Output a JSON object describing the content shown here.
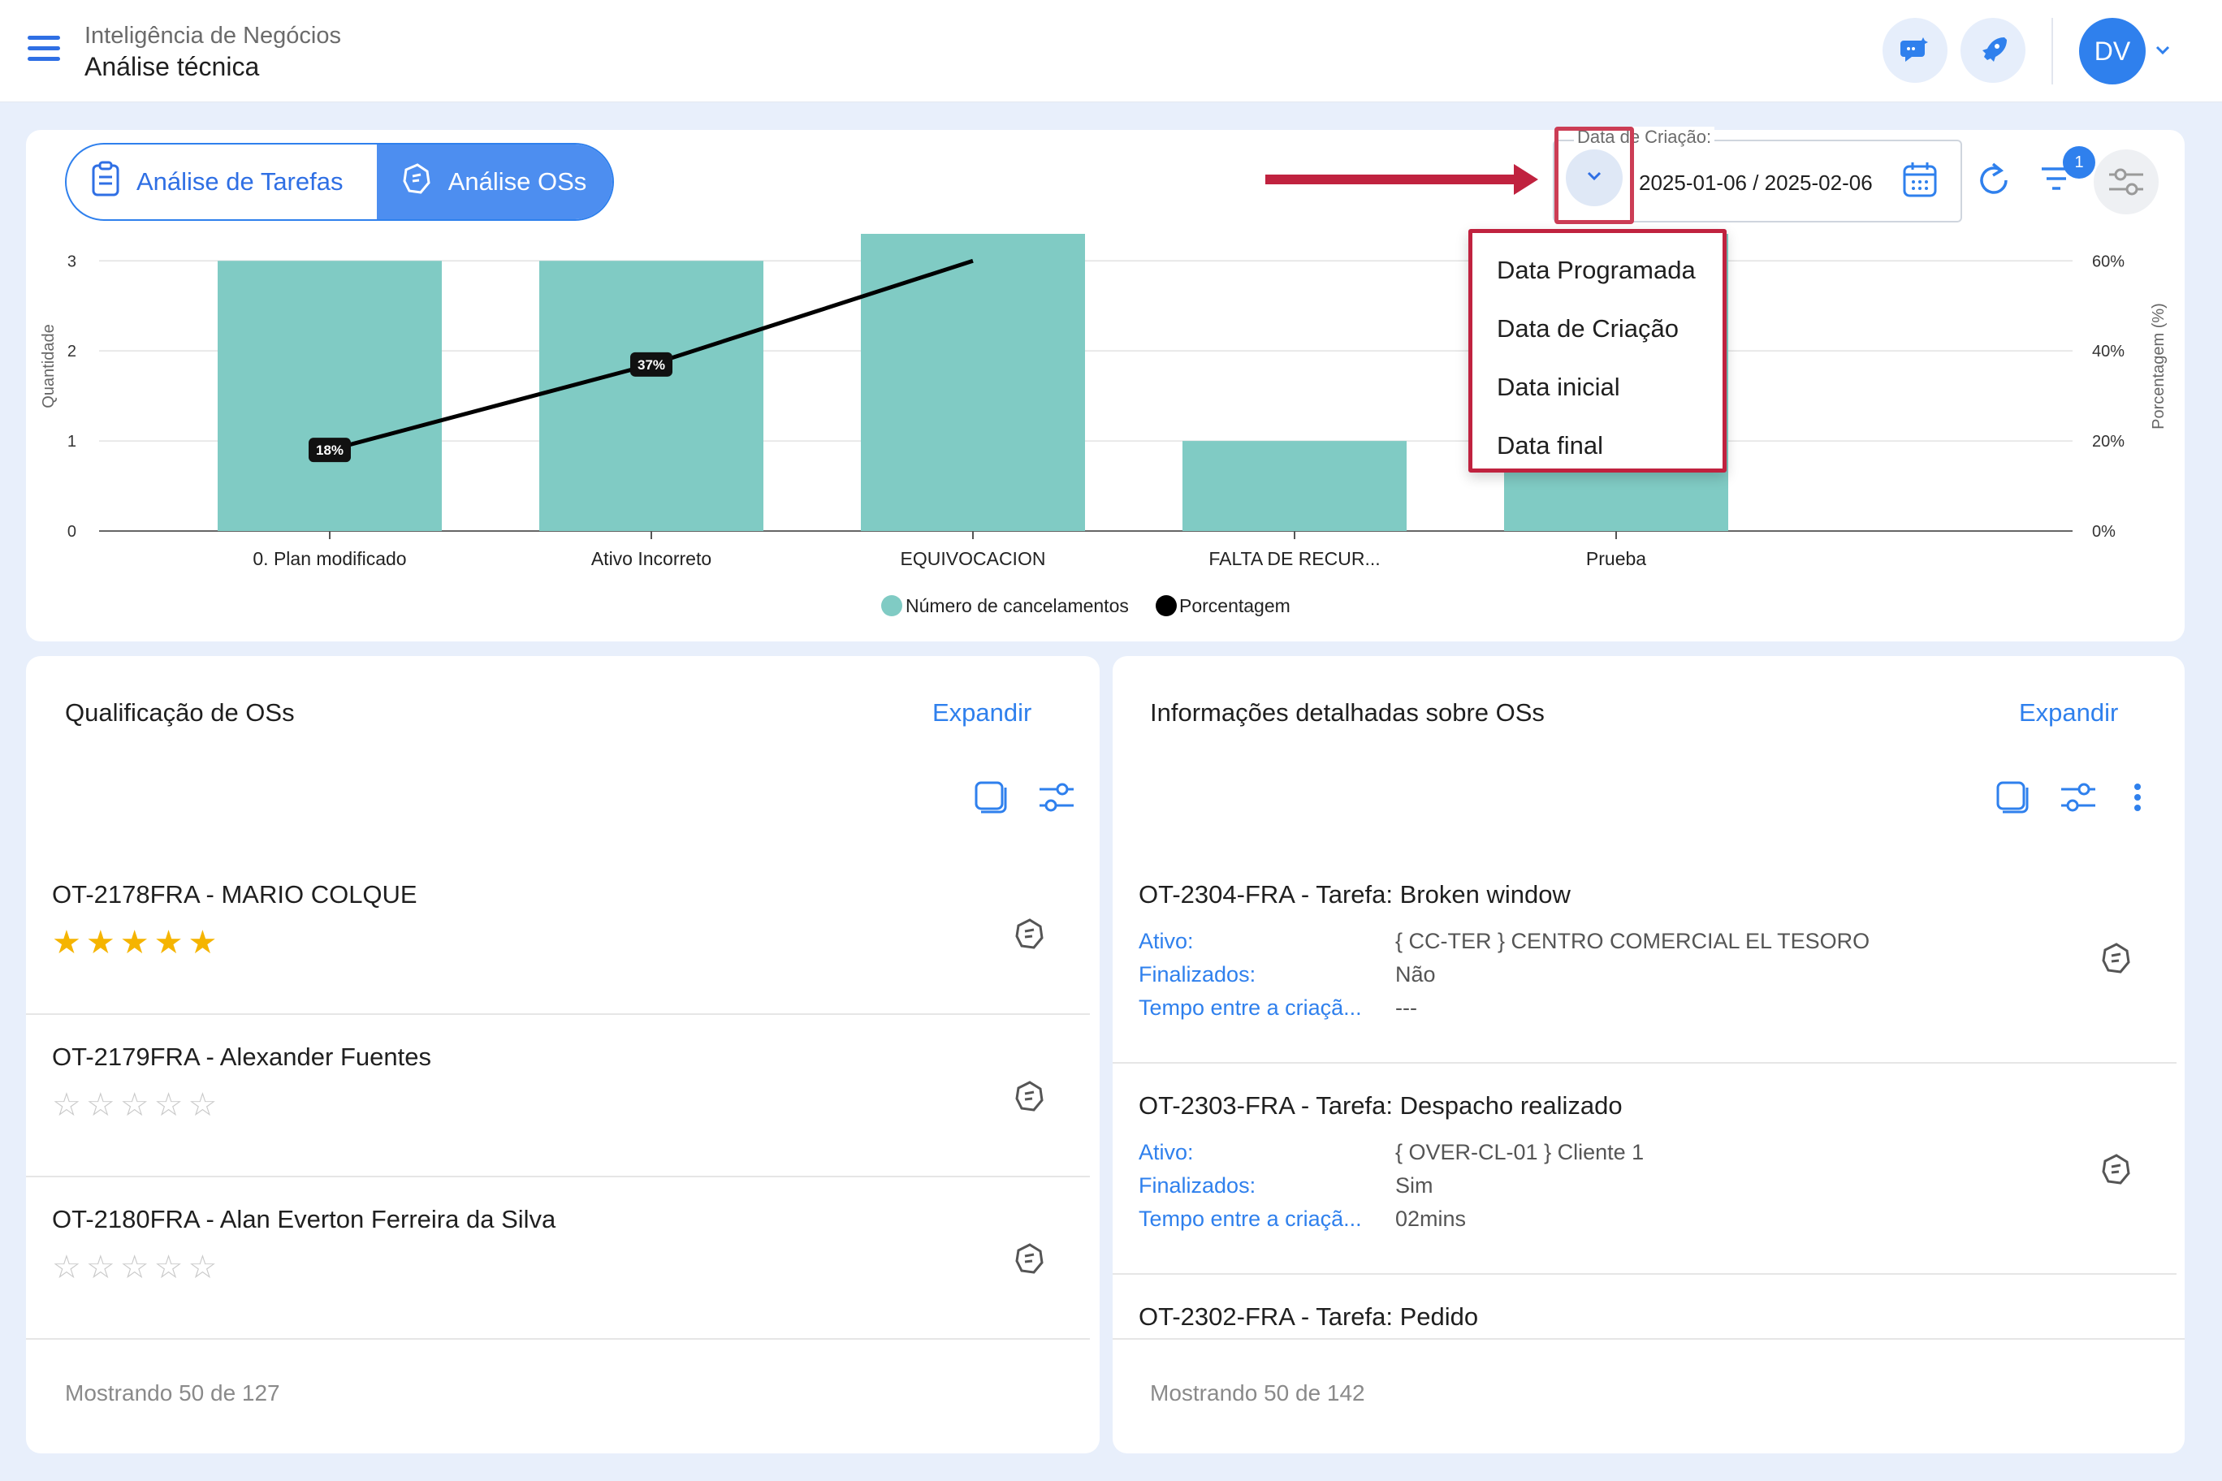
{
  "header": {
    "subtitle": "Inteligência de Negócios",
    "title": "Análise técnica",
    "avatar_initials": "DV"
  },
  "tabs": [
    {
      "label": "Análise de Tarefas",
      "active": false
    },
    {
      "label": "Análise OSs",
      "active": true
    }
  ],
  "date_filter": {
    "label": "Data de Criação:",
    "value": "2025-01-06 / 2025-02-06",
    "options": [
      "Data Programada",
      "Data de Criação",
      "Data inicial",
      "Data final"
    ]
  },
  "filter_badge": "1",
  "chart_data": {
    "type": "bar",
    "categories": [
      "0. Plan modificado",
      "Ativo Incorreto",
      "EQUIVOCACION",
      "FALTA DE RECUR...",
      "Prueba"
    ],
    "series": [
      {
        "name": "Número de cancelamentos",
        "type": "bar",
        "color": "#80cbc4",
        "values": [
          3,
          3,
          3.3,
          1,
          3.3
        ]
      },
      {
        "name": "Porcentagem",
        "type": "line",
        "color": "#000000",
        "values": [
          18,
          37,
          60,
          null,
          null
        ],
        "labels": [
          "18%",
          "37%",
          null,
          null,
          null
        ]
      }
    ],
    "ylabel": "Quantidade",
    "y2label": "Porcentagem (%)",
    "y_ticks": [
      "0",
      "1",
      "2",
      "3"
    ],
    "y2_ticks": [
      "0%",
      "20%",
      "40%",
      "60%"
    ],
    "ylim": [
      0,
      3.3
    ],
    "y2lim": [
      0,
      66
    ],
    "legend": [
      "Número de cancelamentos",
      "Porcentagem"
    ],
    "legend_position": "bottom"
  },
  "left_card": {
    "title": "Qualificação de OSs",
    "expand": "Expandir",
    "rows": [
      {
        "title": "OT-2178FRA - MARIO COLQUE",
        "rating": 5
      },
      {
        "title": "OT-2179FRA - Alexander Fuentes",
        "rating": 0
      },
      {
        "title": "OT-2180FRA - Alan Everton Ferreira da Silva",
        "rating": 0
      }
    ],
    "footer": "Mostrando 50 de 127"
  },
  "right_card": {
    "title": "Informações detalhadas sobre OSs",
    "expand": "Expandir",
    "rows": [
      {
        "title": "OT-2304-FRA - Tarefa: Broken window",
        "ativo_k": "Ativo:",
        "ativo": "{ CC-TER } CENTRO COMERCIAL EL TESORO",
        "fin_k": "Finalizados:",
        "fin": "Não",
        "tempo_k": "Tempo entre a criaçã...",
        "tempo": "---"
      },
      {
        "title": "OT-2303-FRA - Tarefa: Despacho realizado",
        "ativo_k": "Ativo:",
        "ativo": "{ OVER-CL-01 } Cliente 1",
        "fin_k": "Finalizados:",
        "fin": "Sim",
        "tempo_k": "Tempo entre a criaçã...",
        "tempo": "02mins"
      },
      {
        "title": "OT-2302-FRA - Tarefa: Pedido"
      }
    ],
    "footer": "Mostrando 50 de 142"
  },
  "colors": {
    "accent": "#2f80ed",
    "highlight": "#c0223f",
    "bar": "#80cbc4",
    "star": "#f5b400"
  },
  "icons": [
    "menu-icon",
    "chat-icon",
    "rocket-icon",
    "chevron-down-icon",
    "clipboard-icon",
    "rating-icon",
    "calendar-icon",
    "refresh-icon",
    "filter-icon",
    "settings-icon",
    "copy-icon",
    "sliders-icon",
    "more-vert-icon",
    "arrow-right-icon"
  ]
}
